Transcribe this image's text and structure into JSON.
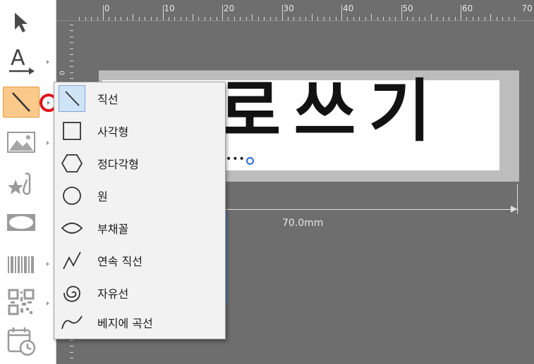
{
  "ruler": {
    "marks": [
      "0",
      "10",
      "20",
      "30",
      "40",
      "50",
      "60",
      "70"
    ],
    "zero_label": "0"
  },
  "label": {
    "text": "로쓰기"
  },
  "dimension": {
    "width_label": "70.0mm"
  },
  "toolbar": {
    "tools": [
      {
        "name": "select",
        "icon": "cursor-arrow-icon"
      },
      {
        "name": "text",
        "icon": "text-tool-icon",
        "text_glyph": "A"
      },
      {
        "name": "line",
        "icon": "line-tool-icon",
        "active": true
      },
      {
        "name": "image",
        "icon": "image-tool-icon"
      },
      {
        "name": "clipart",
        "icon": "clipart-star-icon"
      },
      {
        "name": "frame",
        "icon": "frame-ellipse-icon"
      },
      {
        "name": "barcode",
        "icon": "barcode-icon"
      },
      {
        "name": "qr-code",
        "icon": "qr-code-icon"
      },
      {
        "name": "date-time",
        "icon": "calendar-clock-icon"
      }
    ]
  },
  "shape_menu": {
    "items": [
      {
        "label": "직선",
        "icon": "straight-line-icon",
        "selected": true
      },
      {
        "label": "사각형",
        "icon": "rectangle-icon"
      },
      {
        "label": "정다각형",
        "icon": "polygon-icon"
      },
      {
        "label": "원",
        "icon": "circle-icon"
      },
      {
        "label": "부채꼴",
        "icon": "sector-icon"
      },
      {
        "label": "연속 직선",
        "icon": "polyline-icon"
      },
      {
        "label": "자유선",
        "icon": "freehand-spiral-icon"
      },
      {
        "label": "베지에 곡선",
        "icon": "bezier-curve-icon"
      }
    ]
  },
  "colors": {
    "highlight": "#e0101a",
    "active_tool_bg": "#fbc98a",
    "selected_item_bg": "#cfe3f7",
    "handle": "#2b6cd6"
  }
}
